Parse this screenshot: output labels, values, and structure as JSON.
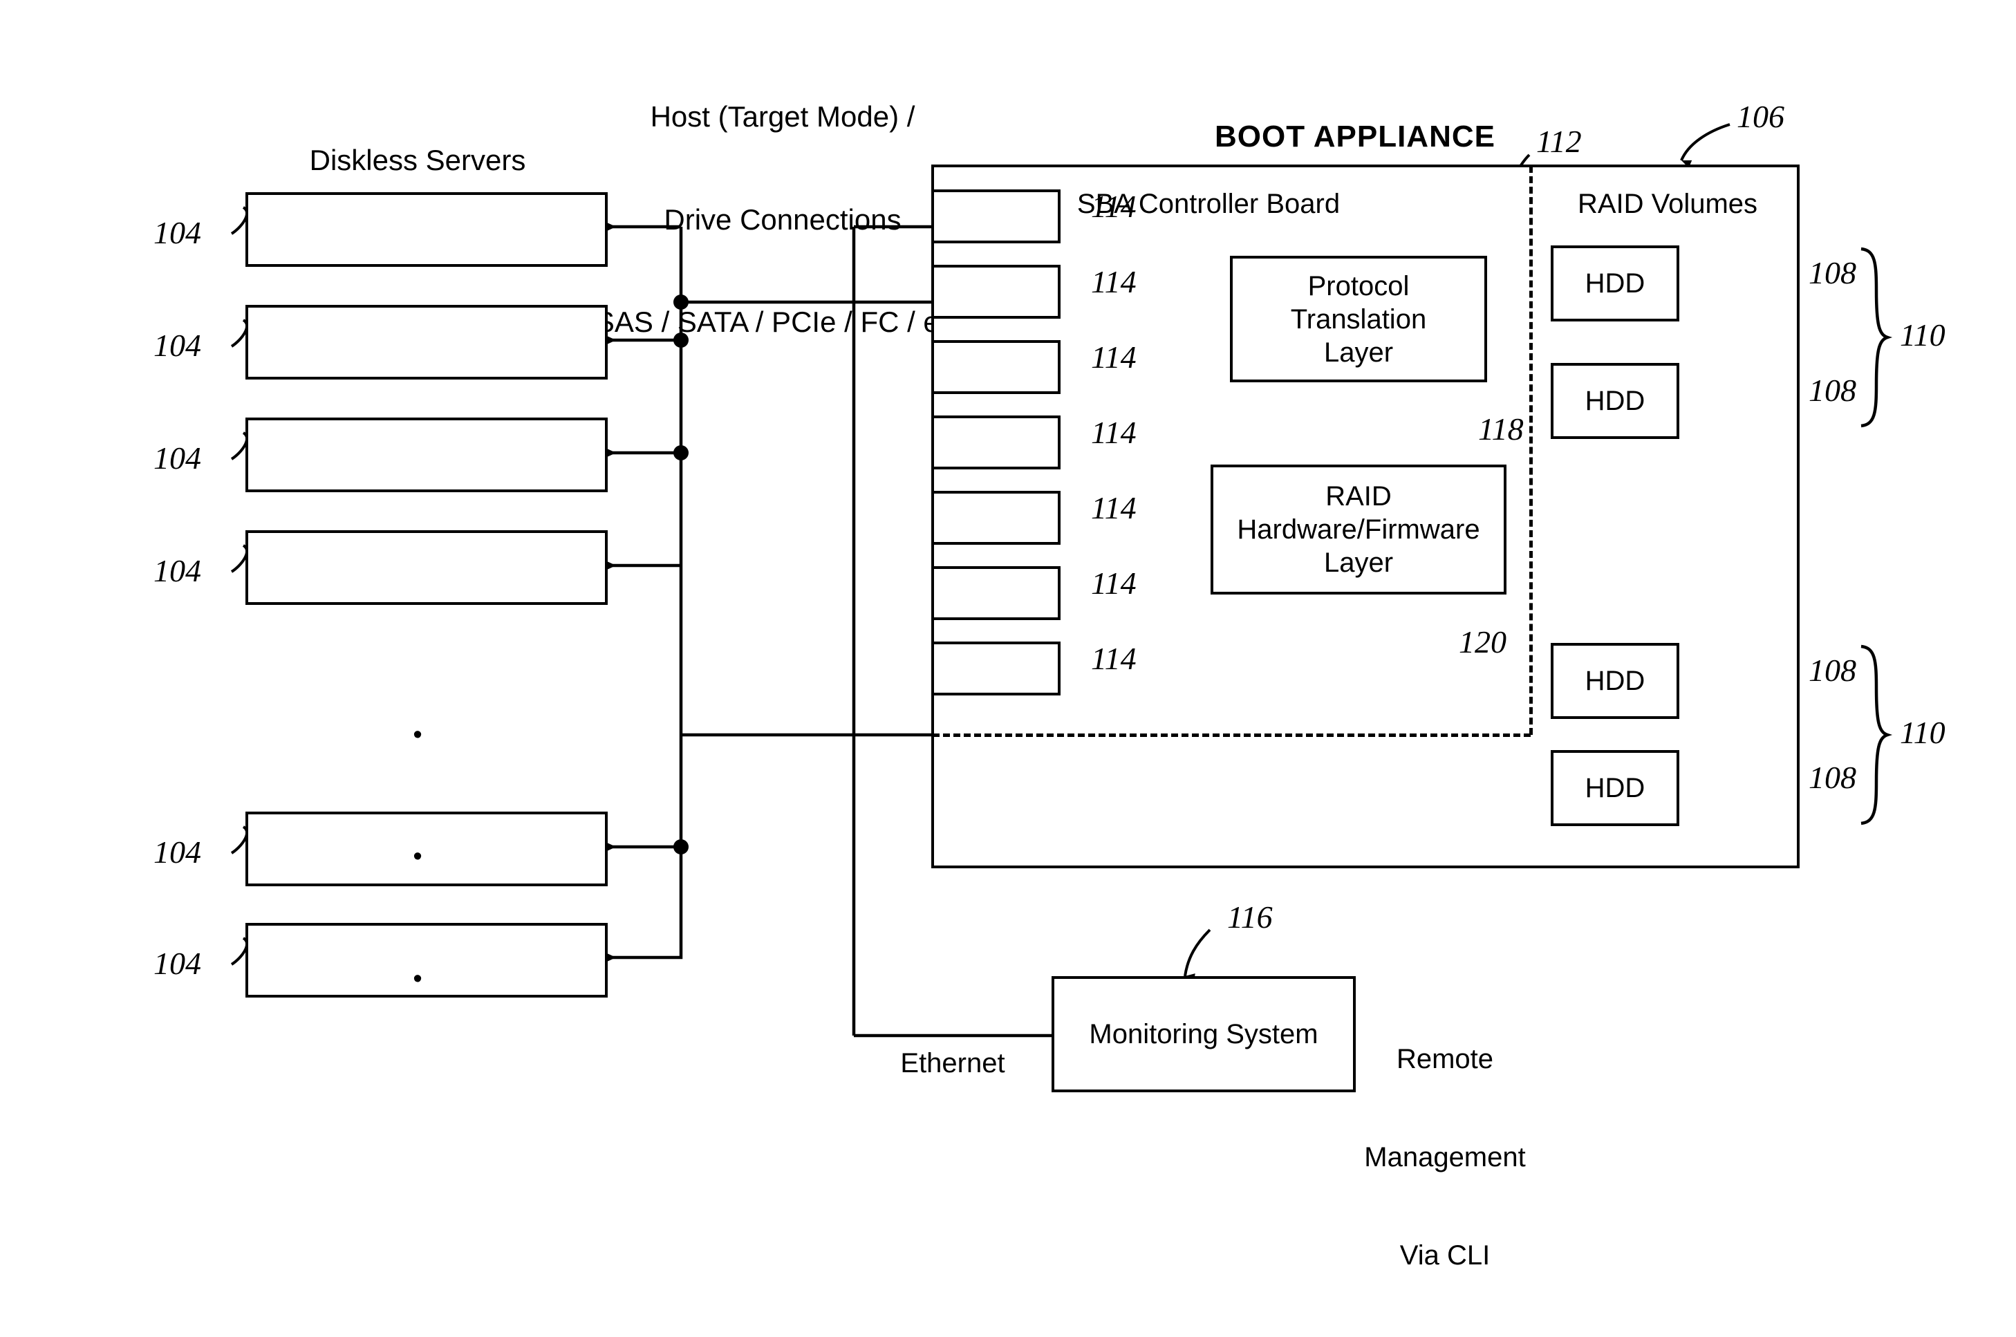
{
  "figure": {
    "title_top": "Host (Target Mode) /\nDrive Connections\n(SAS / SATA / PCIe / FC / etc.)",
    "title_top_line1": "Host (Target Mode) /",
    "title_top_line2": "Drive Connections",
    "title_top_line3": "(SAS / SATA / PCIe / FC / etc.)",
    "servers_heading": "Diskless Servers",
    "appliance_heading": "BOOT APPLIANCE",
    "sba_heading": "SBA Controller Board",
    "raid_heading": "RAID Volumes",
    "ethernet_label": "Ethernet",
    "remote_mgmt_line1": "Remote",
    "remote_mgmt_line2": "Management",
    "remote_mgmt_line3": "Via CLI",
    "ellipsis_glyph": "•"
  },
  "reference_numerals": {
    "appliance": "106",
    "hdd": "108",
    "raid_volume_group": "110",
    "sba_board": "112",
    "port": "114",
    "monitoring_system": "116",
    "protocol_translation_layer": "118",
    "raid_hw_fw_layer": "120",
    "server": "104"
  },
  "servers": [
    {
      "id": "104",
      "index": 1
    },
    {
      "id": "104",
      "index": 2
    },
    {
      "id": "104",
      "index": 3
    },
    {
      "id": "104",
      "index": 4
    },
    {
      "id": "104",
      "index": 5
    },
    {
      "id": "104",
      "index": 6
    }
  ],
  "ports": [
    {
      "ref": "114",
      "index": 1
    },
    {
      "ref": "114",
      "index": 2
    },
    {
      "ref": "114",
      "index": 3
    },
    {
      "ref": "114",
      "index": 4
    },
    {
      "ref": "114",
      "index": 5
    },
    {
      "ref": "114",
      "index": 6
    },
    {
      "ref": "114",
      "index": 7
    }
  ],
  "sba_blocks": [
    {
      "label": "Protocol\nTranslation\nLayer",
      "ref": "118"
    },
    {
      "label": "RAID\nHardware/Firmware\nLayer",
      "ref": "120"
    }
  ],
  "hdds": [
    {
      "label": "HDD",
      "ref": "108",
      "group": "110",
      "index": 1
    },
    {
      "label": "HDD",
      "ref": "108",
      "group": "110",
      "index": 2
    },
    {
      "label": "HDD",
      "ref": "108",
      "group": "110",
      "index": 3
    },
    {
      "label": "HDD",
      "ref": "108",
      "group": "110",
      "index": 4
    }
  ],
  "raid_groups": [
    {
      "ref": "110",
      "index": 1
    },
    {
      "ref": "110",
      "index": 2
    }
  ],
  "monitoring": {
    "label": "Monitoring System",
    "ref": "116"
  },
  "colors": {
    "stroke": "#000000",
    "background": "#ffffff"
  }
}
